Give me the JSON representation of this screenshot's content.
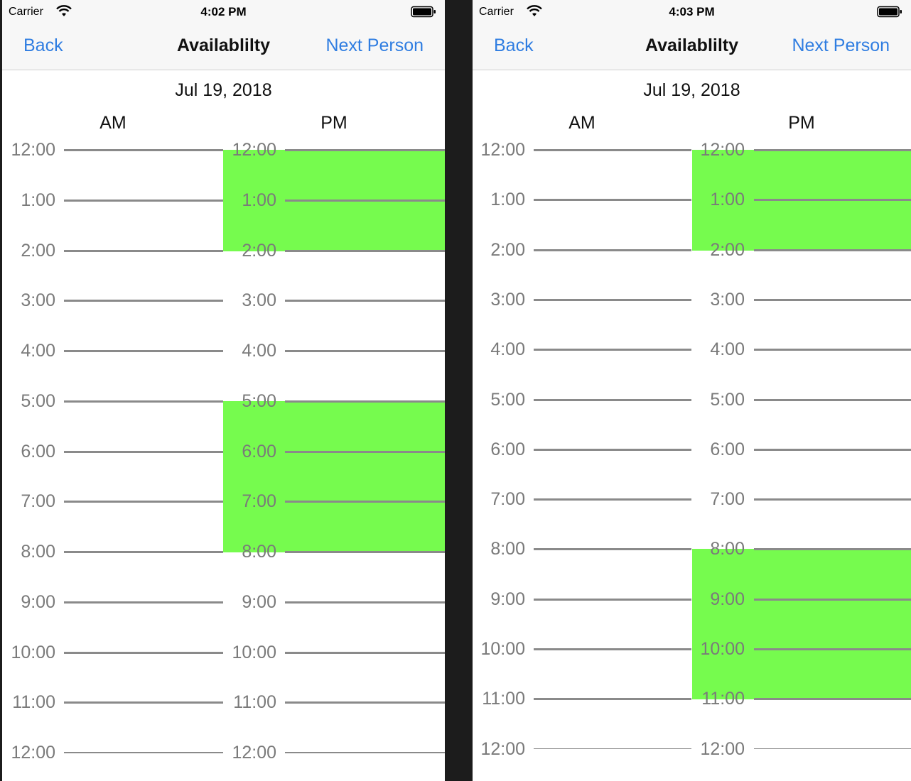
{
  "screens": [
    {
      "status": {
        "carrier": "Carrier",
        "time": "4:02 PM"
      },
      "nav": {
        "back": "Back",
        "title": "Availablilty",
        "next": "Next Person"
      },
      "date": "Jul 19, 2018",
      "columns": {
        "am": "AM",
        "pm": "PM"
      },
      "hours": [
        "12:00",
        "1:00",
        "2:00",
        "3:00",
        "4:00",
        "5:00",
        "6:00",
        "7:00",
        "8:00",
        "9:00",
        "10:00",
        "11:00",
        "12:00"
      ],
      "pm_available": [
        {
          "start": 0,
          "end": 2
        },
        {
          "start": 5,
          "end": 8
        }
      ]
    },
    {
      "status": {
        "carrier": "Carrier",
        "time": "4:03 PM"
      },
      "nav": {
        "back": "Back",
        "title": "Availablilty",
        "next": "Next Person"
      },
      "date": "Jul 19, 2018",
      "columns": {
        "am": "AM",
        "pm": "PM"
      },
      "hours": [
        "12:00",
        "1:00",
        "2:00",
        "3:00",
        "4:00",
        "5:00",
        "6:00",
        "7:00",
        "8:00",
        "9:00",
        "10:00",
        "11:00",
        "12:00"
      ],
      "pm_available": [
        {
          "start": 0,
          "end": 2
        },
        {
          "start": 8,
          "end": 11
        }
      ]
    }
  ],
  "colors": {
    "available": "#76fb4e",
    "link": "#2f7de1",
    "line": "#8a8a8a"
  }
}
